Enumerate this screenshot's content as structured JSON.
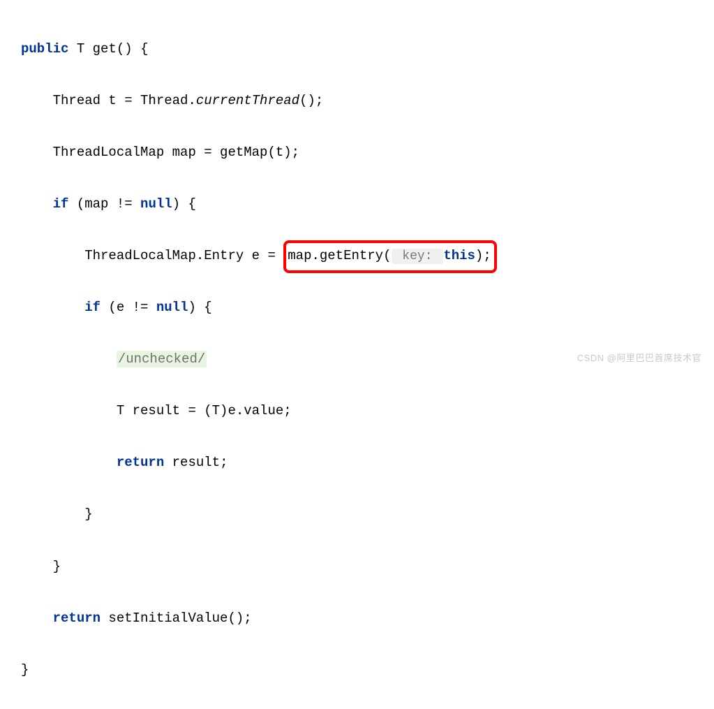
{
  "code": {
    "line1": {
      "kw_public": "public",
      "type_T": "T",
      "method_get": "get",
      "rest": "() {"
    },
    "line2": {
      "t1": "Thread t = Thread.",
      "method": "currentThread",
      "t2": "();"
    },
    "line3": {
      "text": "ThreadLocalMap map = getMap(t);"
    },
    "line4": {
      "kw_if": "if",
      "t1": " (map != ",
      "kw_null": "null",
      "t2": ") {"
    },
    "line5": {
      "t1": "ThreadLocalMap.Entry e = ",
      "hl1": "map.getEntry(",
      "hint": " key: ",
      "kw_this": "this",
      "hl2": ");"
    },
    "line6": {
      "kw_if": "if",
      "t1": " (e != ",
      "kw_null": "null",
      "t2": ") {"
    },
    "line7": {
      "text": "/unchecked/"
    },
    "line8": {
      "text": "T result = (T)e.value;"
    },
    "line9": {
      "kw_return": "return",
      "text": " result;"
    },
    "line10": {
      "text": "}"
    },
    "line11": {
      "text": "}"
    },
    "line12": {
      "kw_return": "return",
      "text": " setInitialValue();"
    },
    "line13": {
      "text": "}"
    }
  },
  "watermark": "CSDN @阿里巴巴首席技术官"
}
